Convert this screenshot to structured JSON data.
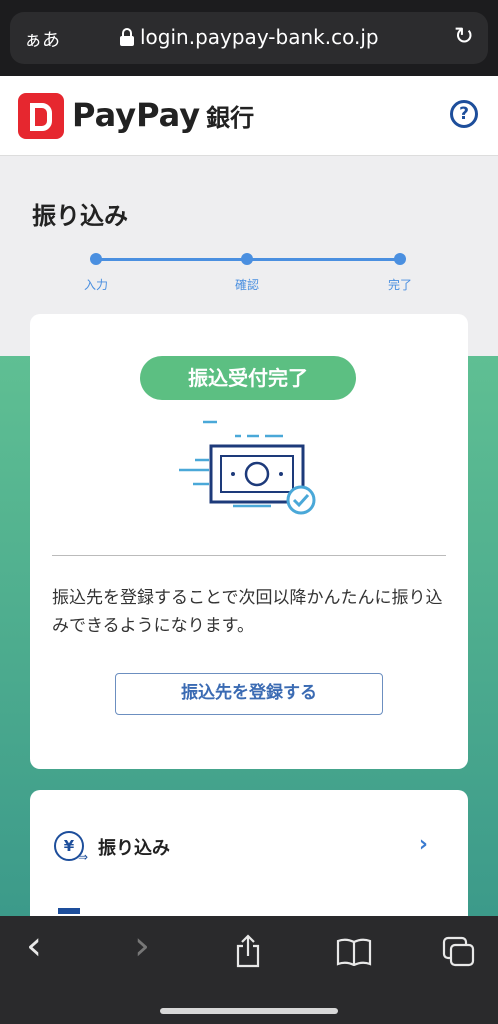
{
  "browser": {
    "aa_label": "ぁあ",
    "url": "login.paypay-bank.co.jp",
    "reload_icon": "↻"
  },
  "header": {
    "logo_text": "PayPay",
    "logo_bank": "銀行",
    "help_label": "?"
  },
  "page": {
    "title": "振り込み",
    "steps": [
      "入力",
      "確認",
      "完了"
    ]
  },
  "result_card": {
    "status_badge": "振込受付完了",
    "description": "振込先を登録することで次回以降かんたんに振り込みできるようになります。",
    "register_button": "振込先を登録する"
  },
  "menu": {
    "items": [
      {
        "label": "振り込み",
        "icon": "yen-transfer-icon",
        "icon_glyph": "¥"
      }
    ]
  },
  "toolbar": {
    "back": "‹",
    "forward": "›",
    "share": "share-icon",
    "bookmarks": "book-icon",
    "tabs": "tabs-icon"
  },
  "colors": {
    "brand_red": "#e6272f",
    "accent_blue": "#4a8fe0",
    "success_green": "#5cbf82",
    "navy": "#1d4e9b"
  }
}
